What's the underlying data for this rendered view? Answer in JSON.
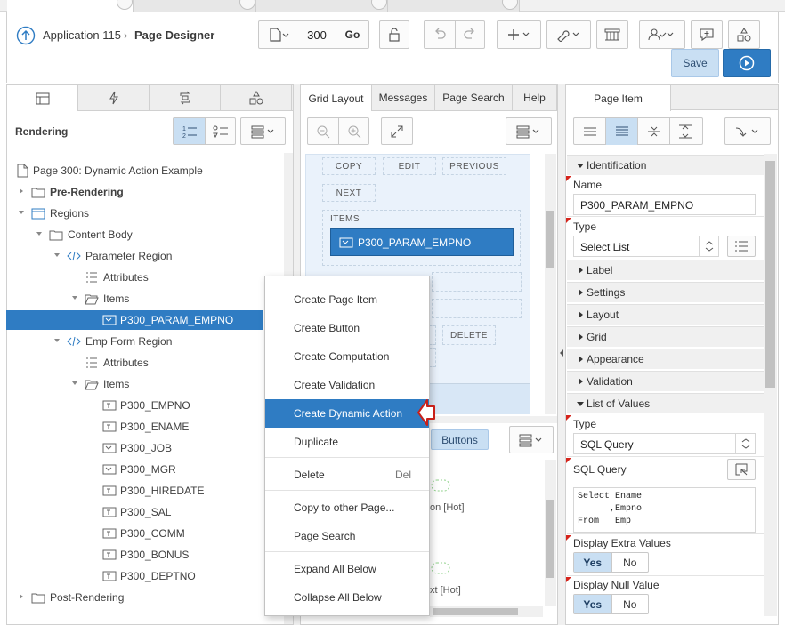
{
  "breadcrumb": {
    "app": "Application 115",
    "page": "Page Designer"
  },
  "toolbar": {
    "page_number": "300",
    "go_label": "Go",
    "save_label": "Save"
  },
  "left_pane": {
    "title": "Rendering",
    "tree": [
      {
        "label": "Page 300: Dynamic Action Example",
        "icon": "page-icon"
      },
      {
        "label": "Pre-Rendering",
        "icon": "folder-icon"
      },
      {
        "label": "Regions",
        "icon": "region-icon"
      },
      {
        "label": "Content Body",
        "icon": "folder-icon"
      },
      {
        "label": "Parameter Region",
        "icon": "code-icon"
      },
      {
        "label": "Attributes",
        "icon": "list-icon"
      },
      {
        "label": "Items",
        "icon": "folder-open-icon"
      },
      {
        "label": "P300_PARAM_EMPNO",
        "icon": "select-list-icon"
      },
      {
        "label": "Emp Form Region",
        "icon": "code-icon"
      },
      {
        "label": "Attributes",
        "icon": "list-icon"
      },
      {
        "label": "Items",
        "icon": "folder-open-icon"
      },
      {
        "label": "P300_EMPNO",
        "icon": "text-field-icon"
      },
      {
        "label": "P300_ENAME",
        "icon": "text-field-icon"
      },
      {
        "label": "P300_JOB",
        "icon": "select-list-icon"
      },
      {
        "label": "P300_MGR",
        "icon": "select-list-icon"
      },
      {
        "label": "P300_HIREDATE",
        "icon": "text-field-icon"
      },
      {
        "label": "P300_SAL",
        "icon": "text-field-icon"
      },
      {
        "label": "P300_COMM",
        "icon": "text-field-icon"
      },
      {
        "label": "P300_BONUS",
        "icon": "text-field-icon"
      },
      {
        "label": "P300_DEPTNO",
        "icon": "text-field-icon"
      },
      {
        "label": "Post-Rendering",
        "icon": "folder-icon"
      }
    ]
  },
  "middle_pane": {
    "tabs": [
      "Grid Layout",
      "Messages",
      "Page Search",
      "Help"
    ],
    "grid": {
      "buttons_row": [
        "COPY",
        "EDIT",
        "PREVIOUS",
        "NEXT"
      ],
      "items_label": "ITEMS",
      "selected_item": "P300_PARAM_EMPNO",
      "delete_slot": "DELETE"
    },
    "gallery": {
      "active_tab": "Buttons",
      "item_label_1": "on [Hot]",
      "item_label_2": "xt [Hot]"
    }
  },
  "context_menu": {
    "items": [
      {
        "label": "Create Page Item"
      },
      {
        "label": "Create Button"
      },
      {
        "label": "Create Computation"
      },
      {
        "label": "Create Validation"
      },
      {
        "label": "Create Dynamic Action"
      },
      {
        "label": "Duplicate"
      },
      {
        "label": "Delete",
        "shortcut": "Del"
      },
      {
        "label": "Copy to other Page..."
      },
      {
        "label": "Page Search"
      },
      {
        "label": "Expand All Below"
      },
      {
        "label": "Collapse All Below"
      }
    ]
  },
  "right_pane": {
    "tab": "Page Item",
    "identification": {
      "group": "Identification",
      "name_label": "Name",
      "name_value": "P300_PARAM_EMPNO",
      "type_label": "Type",
      "type_value": "Select List"
    },
    "collapsed_groups": [
      "Label",
      "Settings",
      "Layout",
      "Grid",
      "Appearance",
      "Validation"
    ],
    "lov": {
      "group": "List of Values",
      "type_label": "Type",
      "type_value": "SQL Query",
      "sql_label": "SQL Query",
      "sql_code": "Select Ename\n      ,Empno\nFrom   Emp",
      "extra_label": "Display Extra Values",
      "null_label": "Display Null Value",
      "yes": "Yes",
      "no": "No"
    }
  },
  "colors": {
    "accent": "#2f7cc3",
    "selected_light": "#c9dff3",
    "required_marker": "#d6241c"
  }
}
